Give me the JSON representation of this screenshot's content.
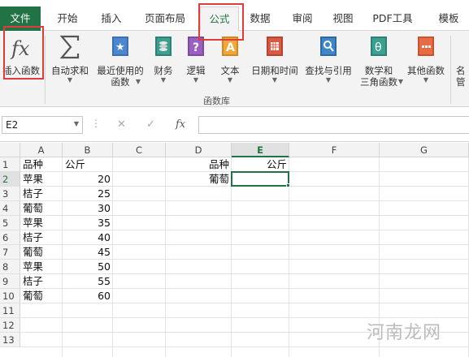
{
  "tabs": [
    {
      "label": "文件"
    },
    {
      "label": "开始"
    },
    {
      "label": "插入"
    },
    {
      "label": "页面布局"
    },
    {
      "label": "公式"
    },
    {
      "label": "数据"
    },
    {
      "label": "审阅"
    },
    {
      "label": "视图"
    },
    {
      "label": "PDF工具"
    },
    {
      "label": "模板"
    }
  ],
  "ribbon": {
    "group_label": "函数库",
    "buttons": [
      {
        "label": "插入函数",
        "label2": "",
        "icon": "fx-icon"
      },
      {
        "label": "自动求和",
        "label2": "",
        "icon": "sigma-icon"
      },
      {
        "label": "最近使用的",
        "label2": "函数",
        "icon": "star-book-icon"
      },
      {
        "label": "财务",
        "label2": "",
        "icon": "coins-book-icon"
      },
      {
        "label": "逻辑",
        "label2": "",
        "icon": "question-book-icon"
      },
      {
        "label": "文本",
        "label2": "",
        "icon": "text-book-icon"
      },
      {
        "label": "日期和时间",
        "label2": "",
        "icon": "calendar-book-icon"
      },
      {
        "label": "查找与引用",
        "label2": "",
        "icon": "search-book-icon"
      },
      {
        "label": "数学和",
        "label2": "三角函数",
        "icon": "theta-book-icon"
      },
      {
        "label": "其他函数",
        "label2": "",
        "icon": "more-book-icon"
      },
      {
        "label": "名",
        "label2": "管",
        "icon": "name-manager-icon"
      }
    ]
  },
  "formula_bar": {
    "name_box": "E2",
    "fx_label": "fx",
    "cancel_symbol": "✕",
    "enter_symbol": "✓",
    "value": ""
  },
  "sheet": {
    "columns": [
      "A",
      "B",
      "C",
      "D",
      "E",
      "F",
      "G"
    ],
    "rows": [
      "1",
      "2",
      "3",
      "4",
      "5",
      "6",
      "7",
      "8",
      "9",
      "10",
      "11",
      "12",
      "13"
    ],
    "selected_cell": "E2",
    "cells": {
      "A1": "品种",
      "B1": "公斤",
      "A2": "苹果",
      "B2": "20",
      "A3": "桔子",
      "B3": "25",
      "A4": "葡萄",
      "B4": "30",
      "A5": "苹果",
      "B5": "35",
      "A6": "桔子",
      "B6": "40",
      "A7": "葡萄",
      "B7": "45",
      "A8": "苹果",
      "B8": "50",
      "A9": "桔子",
      "B9": "55",
      "A10": "葡萄",
      "B10": "60",
      "D1": "品种",
      "E1": "公斤",
      "D2": "葡萄"
    }
  },
  "watermark": "河南龙网",
  "colors": {
    "excel_green": "#217346",
    "highlight_red": "#e23b3b"
  }
}
